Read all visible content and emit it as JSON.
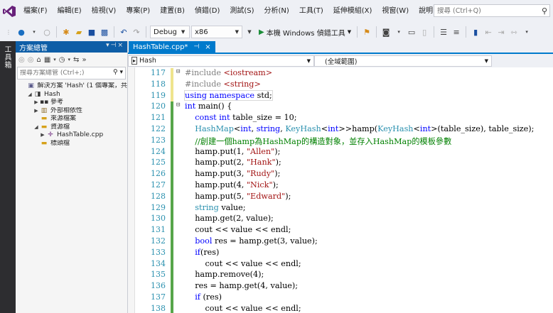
{
  "menu": [
    "檔案(F)",
    "編輯(E)",
    "檢視(V)",
    "專案(P)",
    "建置(B)",
    "偵錯(D)",
    "測試(S)",
    "分析(N)",
    "工具(T)",
    "延伸模組(X)",
    "視窗(W)",
    "說明(H)"
  ],
  "search": {
    "placeholder": "搜尋 (Ctrl+Q)"
  },
  "toolbar": {
    "config": "Debug",
    "platform": "x86",
    "run_label": "本機 Windows 偵錯工具"
  },
  "toolbox_label": "工具箱",
  "solution_explorer": {
    "title": "方案總管",
    "search_placeholder": "搜尋方案總管 (Ctrl+;)",
    "items": [
      {
        "label": "解決方案 'Hash' (1 個專案，共",
        "indent": 0,
        "icon": "solution-icon",
        "twist": ""
      },
      {
        "label": "Hash",
        "indent": 1,
        "icon": "project-icon",
        "twist": "▲"
      },
      {
        "label": "參考",
        "indent": 2,
        "icon": "references-icon",
        "twist": "▶"
      },
      {
        "label": "外部相依性",
        "indent": 2,
        "icon": "external-deps-icon",
        "twist": "▶"
      },
      {
        "label": "來源檔案",
        "indent": 2,
        "icon": "folder-icon",
        "twist": ""
      },
      {
        "label": "資源檔",
        "indent": 2,
        "icon": "folder-icon",
        "twist": "▲"
      },
      {
        "label": "HashTable.cpp",
        "indent": 3,
        "icon": "cpp-file-icon",
        "twist": "▶"
      },
      {
        "label": "標頭檔",
        "indent": 2,
        "icon": "folder-icon",
        "twist": ""
      }
    ]
  },
  "editor": {
    "tab_label": "HashTable.cpp*",
    "nav_scope": "Hash",
    "nav_member": "(全域範圍)",
    "lines": [
      {
        "n": "117",
        "code": [
          [
            "pp",
            "#include "
          ],
          [
            "str",
            "<iostream>"
          ]
        ],
        "fold": "⊟",
        "chg": "y"
      },
      {
        "n": "118",
        "code": [
          [
            "pp",
            "#include "
          ],
          [
            "str",
            "<string>"
          ]
        ],
        "fold": "",
        "chg": "y"
      },
      {
        "n": "119",
        "code": [
          [
            "kw",
            "using namespace "
          ],
          [
            "",
            "std;"
          ]
        ],
        "fold": "",
        "chg": "y",
        "box": true
      },
      {
        "n": "120",
        "code": [
          [
            "kw",
            "int "
          ],
          [
            "",
            "main() {"
          ]
        ],
        "fold": "⊟",
        "chg": "g"
      },
      {
        "n": "121",
        "code": [
          [
            "",
            "    "
          ],
          [
            "kw",
            "const int "
          ],
          [
            "",
            "table_size = 10;"
          ]
        ],
        "fold": "",
        "chg": "g"
      },
      {
        "n": "122",
        "code": [
          [
            "",
            "    "
          ],
          [
            "typ",
            "HashMap"
          ],
          [
            "",
            "<"
          ],
          [
            "kw",
            "int"
          ],
          [
            "",
            ", "
          ],
          [
            "kw",
            "string"
          ],
          [
            "",
            ", "
          ],
          [
            "typ",
            "KeyHash"
          ],
          [
            "",
            "<"
          ],
          [
            "kw",
            "int"
          ],
          [
            "",
            ">>hamp("
          ],
          [
            "typ",
            "KeyHash"
          ],
          [
            "",
            "<"
          ],
          [
            "kw",
            "int"
          ],
          [
            "",
            ">(table_size), table_size);"
          ]
        ],
        "fold": "",
        "chg": "g"
      },
      {
        "n": "123",
        "code": [
          [
            "",
            "    "
          ],
          [
            "cm",
            "//創建一個hamp為HashMap的構造對象，並存入HashMap的模板參數"
          ]
        ],
        "fold": "",
        "chg": "g"
      },
      {
        "n": "124",
        "code": [
          [
            "",
            "    hamp.put(1, "
          ],
          [
            "str",
            "\"Allen\""
          ],
          [
            "",
            ");"
          ]
        ],
        "fold": "",
        "chg": "g"
      },
      {
        "n": "125",
        "code": [
          [
            "",
            "    hamp.put(2, "
          ],
          [
            "str",
            "\"Hank\""
          ],
          [
            "",
            ");"
          ]
        ],
        "fold": "",
        "chg": "g"
      },
      {
        "n": "126",
        "code": [
          [
            "",
            "    hamp.put(3, "
          ],
          [
            "str",
            "\"Rudy\""
          ],
          [
            "",
            ");"
          ]
        ],
        "fold": "",
        "chg": "g"
      },
      {
        "n": "127",
        "code": [
          [
            "",
            "    hamp.put(4, "
          ],
          [
            "str",
            "\"Nick\""
          ],
          [
            "",
            ");"
          ]
        ],
        "fold": "",
        "chg": "g"
      },
      {
        "n": "128",
        "code": [
          [
            "",
            "    hamp.put(5, "
          ],
          [
            "str",
            "\"Edward\""
          ],
          [
            "",
            ");"
          ]
        ],
        "fold": "",
        "chg": "g"
      },
      {
        "n": "129",
        "code": [
          [
            "",
            "    "
          ],
          [
            "typ",
            "string "
          ],
          [
            "",
            "value;"
          ]
        ],
        "fold": "",
        "chg": "g"
      },
      {
        "n": "130",
        "code": [
          [
            "",
            "    hamp.get(2, value);"
          ]
        ],
        "fold": "",
        "chg": "g"
      },
      {
        "n": "131",
        "code": [
          [
            "",
            "    cout << value << endl;"
          ]
        ],
        "fold": "",
        "chg": "g"
      },
      {
        "n": "132",
        "code": [
          [
            "",
            "    "
          ],
          [
            "kw",
            "bool "
          ],
          [
            "",
            "res = hamp.get(3, value);"
          ]
        ],
        "fold": "",
        "chg": "g"
      },
      {
        "n": "133",
        "code": [
          [
            "",
            "    "
          ],
          [
            "kw",
            "if"
          ],
          [
            "",
            "(res)"
          ]
        ],
        "fold": "",
        "chg": "g"
      },
      {
        "n": "134",
        "code": [
          [
            "",
            "        cout << value << endl;"
          ]
        ],
        "fold": "",
        "chg": "g"
      },
      {
        "n": "135",
        "code": [
          [
            "",
            "    hamp.remove(4);"
          ]
        ],
        "fold": "",
        "chg": "g"
      },
      {
        "n": "136",
        "code": [
          [
            "",
            "    res = hamp.get(4, value);"
          ]
        ],
        "fold": "",
        "chg": "g"
      },
      {
        "n": "137",
        "code": [
          [
            "",
            "    "
          ],
          [
            "kw",
            "if "
          ],
          [
            "",
            "(res)"
          ]
        ],
        "fold": "",
        "chg": "g"
      },
      {
        "n": "138",
        "code": [
          [
            "",
            "        cout << value << endl;"
          ]
        ],
        "fold": "",
        "chg": "g"
      }
    ]
  }
}
